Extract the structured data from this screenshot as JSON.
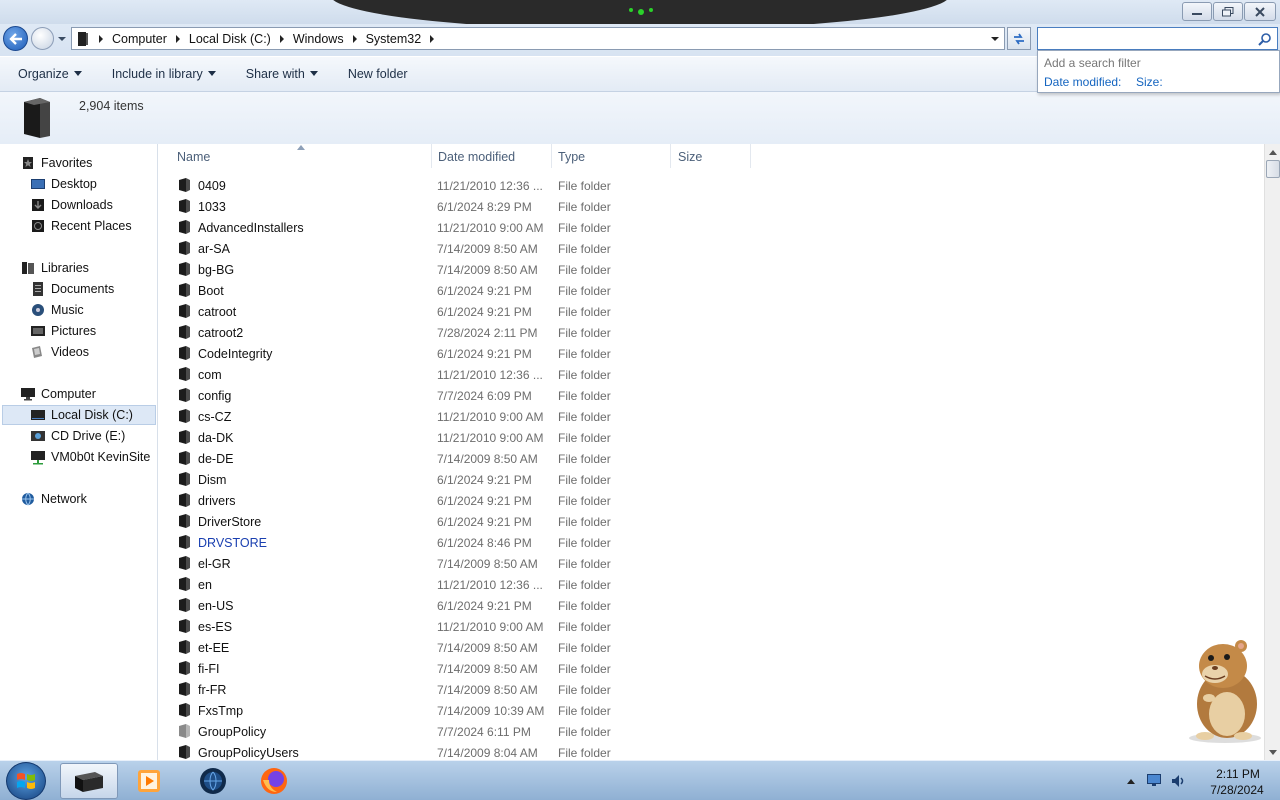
{
  "address": {
    "crumbs": [
      "Computer",
      "Local Disk (C:)",
      "Windows",
      "System32"
    ]
  },
  "search": {
    "filter_title": "Add a search filter",
    "filters": [
      "Date modified:",
      "Size:"
    ]
  },
  "commands": {
    "organize": "Organize",
    "include_in_library": "Include in library",
    "share_with": "Share with",
    "new_folder": "New folder"
  },
  "details": {
    "item_count": "2,904 items"
  },
  "nav": {
    "favorites": "Favorites",
    "desktop": "Desktop",
    "downloads": "Downloads",
    "recent_places": "Recent Places",
    "libraries": "Libraries",
    "documents": "Documents",
    "music": "Music",
    "pictures": "Pictures",
    "videos": "Videos",
    "computer": "Computer",
    "local_disk": "Local Disk (C:)",
    "cd_drive": "CD Drive (E:)",
    "network_share": "VM0b0t KevinSite",
    "network": "Network"
  },
  "columns": {
    "name": "Name",
    "date_modified": "Date modified",
    "type": "Type",
    "size": "Size"
  },
  "files": [
    {
      "name": "0409",
      "date": "11/21/2010 12:36 ...",
      "type": "File folder"
    },
    {
      "name": "1033",
      "date": "6/1/2024 8:29 PM",
      "type": "File folder"
    },
    {
      "name": "AdvancedInstallers",
      "date": "11/21/2010 9:00 AM",
      "type": "File folder"
    },
    {
      "name": "ar-SA",
      "date": "7/14/2009 8:50 AM",
      "type": "File folder"
    },
    {
      "name": "bg-BG",
      "date": "7/14/2009 8:50 AM",
      "type": "File folder"
    },
    {
      "name": "Boot",
      "date": "6/1/2024 9:21 PM",
      "type": "File folder"
    },
    {
      "name": "catroot",
      "date": "6/1/2024 9:21 PM",
      "type": "File folder"
    },
    {
      "name": "catroot2",
      "date": "7/28/2024 2:11 PM",
      "type": "File folder"
    },
    {
      "name": "CodeIntegrity",
      "date": "6/1/2024 9:21 PM",
      "type": "File folder"
    },
    {
      "name": "com",
      "date": "11/21/2010 12:36 ...",
      "type": "File folder"
    },
    {
      "name": "config",
      "date": "7/7/2024 6:09 PM",
      "type": "File folder"
    },
    {
      "name": "cs-CZ",
      "date": "11/21/2010 9:00 AM",
      "type": "File folder"
    },
    {
      "name": "da-DK",
      "date": "11/21/2010 9:00 AM",
      "type": "File folder"
    },
    {
      "name": "de-DE",
      "date": "7/14/2009 8:50 AM",
      "type": "File folder"
    },
    {
      "name": "Dism",
      "date": "6/1/2024 9:21 PM",
      "type": "File folder"
    },
    {
      "name": "drivers",
      "date": "6/1/2024 9:21 PM",
      "type": "File folder"
    },
    {
      "name": "DriverStore",
      "date": "6/1/2024 9:21 PM",
      "type": "File folder"
    },
    {
      "name": "DRVSTORE",
      "date": "6/1/2024 8:46 PM",
      "type": "File folder",
      "color": "#1a3fb0"
    },
    {
      "name": "el-GR",
      "date": "7/14/2009 8:50 AM",
      "type": "File folder"
    },
    {
      "name": "en",
      "date": "11/21/2010 12:36 ...",
      "type": "File folder"
    },
    {
      "name": "en-US",
      "date": "6/1/2024 9:21 PM",
      "type": "File folder"
    },
    {
      "name": "es-ES",
      "date": "11/21/2010 9:00 AM",
      "type": "File folder"
    },
    {
      "name": "et-EE",
      "date": "7/14/2009 8:50 AM",
      "type": "File folder"
    },
    {
      "name": "fi-FI",
      "date": "7/14/2009 8:50 AM",
      "type": "File folder"
    },
    {
      "name": "fr-FR",
      "date": "7/14/2009 8:50 AM",
      "type": "File folder"
    },
    {
      "name": "FxsTmp",
      "date": "7/14/2009 10:39 AM",
      "type": "File folder"
    },
    {
      "name": "GroupPolicy",
      "date": "7/7/2024 6:11 PM",
      "type": "File folder",
      "faded": true
    },
    {
      "name": "GroupPolicyUsers",
      "date": "7/14/2009 8:04 AM",
      "type": "File folder"
    }
  ],
  "clock": {
    "time": "2:11 PM",
    "date": "7/28/2024"
  },
  "colors": {
    "link": "#1565c0",
    "selection": "#dde8f6",
    "taskbar": "#a9c4e2"
  }
}
